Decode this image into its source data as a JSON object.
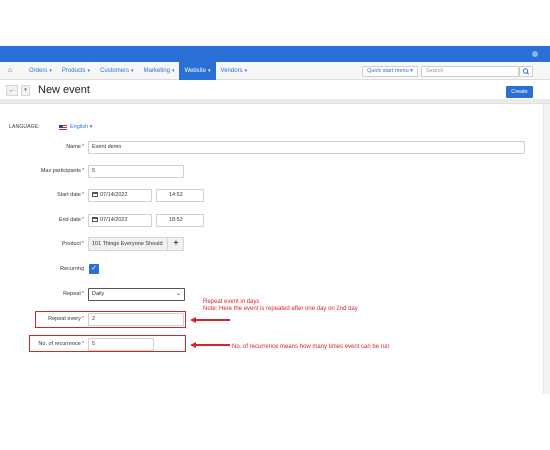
{
  "colors": {
    "accent": "#2a6fd6",
    "annotation": "#d7242a",
    "required": "#c0392b"
  },
  "navbar": {
    "home_icon": "home-icon",
    "items": [
      {
        "label": "Orders"
      },
      {
        "label": "Products"
      },
      {
        "label": "Customers"
      },
      {
        "label": "Marketing"
      },
      {
        "label": "Website",
        "active": true
      },
      {
        "label": "Vendors"
      }
    ],
    "quick_start": "Quick start menu",
    "search_placeholder": "Search"
  },
  "header": {
    "title": "New event",
    "create_label": "Create"
  },
  "language": {
    "label": "LANGUAGE:",
    "value": "English"
  },
  "form": {
    "name": {
      "label": "Name",
      "value": "Event demo"
    },
    "max_participants": {
      "label": "Max participants",
      "value": "5"
    },
    "start_date": {
      "label": "Start date",
      "date": "07/14/2022",
      "time": "14:52"
    },
    "end_date": {
      "label": "End date",
      "date": "07/14/2022",
      "time": "18:52"
    },
    "product": {
      "label": "Product",
      "value": "101 Things Everyone Should"
    },
    "recurring": {
      "label": "Recurring",
      "checked": true
    },
    "repeat": {
      "label": "Repeat",
      "value": "Daily"
    },
    "repeat_every": {
      "label": "Repeat every",
      "value": "2"
    },
    "recurrence": {
      "label": "No. of recurrence",
      "value": "5"
    }
  },
  "annotations": {
    "repeat_note_line1": "Repeat event in days",
    "repeat_note_line2": "Note: Here the event is repeated after one day on 2nd day",
    "recurrence_note": "No. of recurrence means how many times event can be run"
  }
}
